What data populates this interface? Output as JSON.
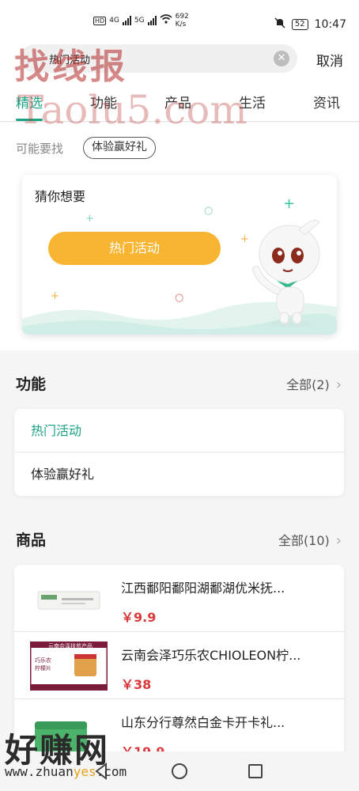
{
  "status_bar": {
    "network_badges": [
      "HD",
      "HD"
    ],
    "net_left": "4G",
    "net_right": "5G",
    "speed_value": "692",
    "speed_unit": "K/s",
    "battery": "52",
    "time": "10:47"
  },
  "search": {
    "value": "热门活动",
    "cancel_label": "取消"
  },
  "tabs": [
    {
      "label": "精选",
      "active": true
    },
    {
      "label": "功能",
      "active": false
    },
    {
      "label": "产品",
      "active": false
    },
    {
      "label": "生活",
      "active": false
    },
    {
      "label": "资讯",
      "active": false
    }
  ],
  "may_look": {
    "label": "可能要找",
    "chip": "体验赢好礼"
  },
  "guess": {
    "title": "猜你想要",
    "button_label": "热门活动"
  },
  "functions": {
    "title": "功能",
    "more_label": "全部(2)",
    "items": [
      "热门活动",
      "体验赢好礼"
    ]
  },
  "products": {
    "title": "商品",
    "more_label": "全部(10)",
    "items": [
      {
        "name": "江西鄱阳鄱阳湖鄱湖优米抚...",
        "price": "￥9.9"
      },
      {
        "name": "云南会泽巧乐农CHIOLEON柠...",
        "price": "￥38",
        "thumb_lines": [
          "云南会泽扶贫产品",
          "巧乐农",
          "柠檬片"
        ]
      },
      {
        "name": "山东分行尊然白金卡开卡礼...",
        "price": "￥19.9"
      }
    ]
  },
  "watermarks": {
    "top": "找线报",
    "url": "Taolu5.com",
    "bottom": "好赚网",
    "bottom_url_pre": "www.zhuan",
    "bottom_url_accent": "yes",
    "bottom_url_post": ".com"
  },
  "colors": {
    "accent": "#1aa383",
    "button": "#f8b531",
    "price": "#d9393a"
  }
}
